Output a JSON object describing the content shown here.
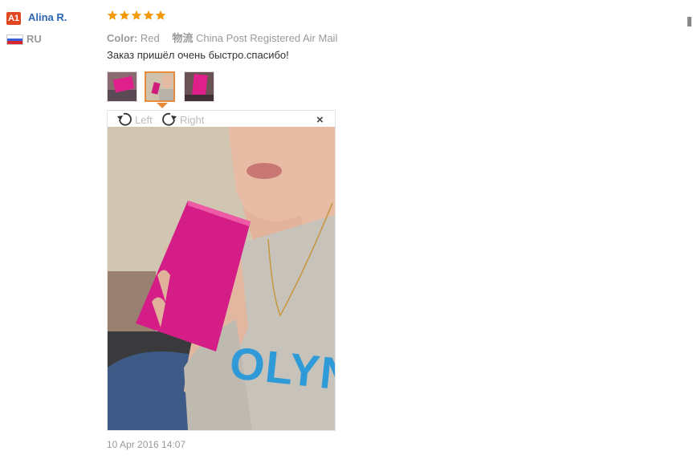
{
  "reviewer": {
    "badge": "A1",
    "name": "Alina R.",
    "country_code": "RU",
    "flag_colors": [
      "#ffffff",
      "#3b5fd6",
      "#d8282f"
    ]
  },
  "review": {
    "rating": 5,
    "max_rating": 5,
    "star_color": "#f59a0c",
    "color_label": "Color:",
    "color_value": "Red",
    "shipping_label": "物流",
    "shipping_value": "China Post Registered Air Mail",
    "text": "Заказ пришёл очень быстро.спасибо!",
    "date": "10 Apr 2016 14:07"
  },
  "gallery": {
    "thumbnails": [
      "photo-1",
      "photo-2",
      "photo-3"
    ],
    "selected_index": 1,
    "selected_border_color": "#e58a3a"
  },
  "viewer": {
    "rotate_left_label": "Left",
    "rotate_right_label": "Right",
    "close_symbol": "×",
    "rotate_left_icon": "rotate-left-icon",
    "rotate_right_icon": "rotate-right-icon",
    "photo_text": "OLYN"
  }
}
